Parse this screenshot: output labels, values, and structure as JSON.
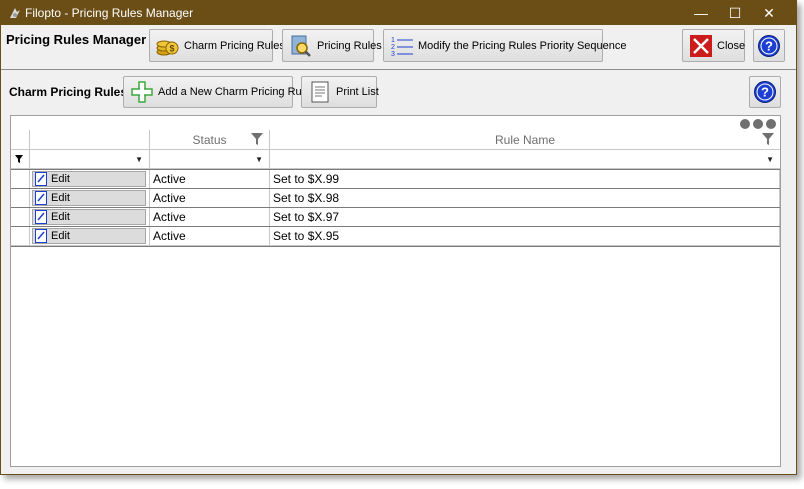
{
  "window": {
    "title": "Filopto - Pricing Rules Manager",
    "controls": {
      "minimize": "—",
      "maximize": "☐",
      "close": "✕"
    }
  },
  "toolbar": {
    "heading": "Pricing Rules Manager",
    "charm_pricing_rules": "Charm Pricing Rules",
    "pricing_rules": "Pricing Rules",
    "modify_priority": "Modify the Pricing Rules Priority Sequence",
    "close": "Close"
  },
  "subtoolbar": {
    "heading": "Charm Pricing Rules",
    "add_rule": "Add a New Charm Pricing Rule",
    "print_list": "Print List"
  },
  "grid": {
    "columns": [
      "",
      "Status",
      "Rule Name"
    ],
    "rows": [
      {
        "action": "Edit",
        "status": "Active",
        "rule_name": "Set to $X.99"
      },
      {
        "action": "Edit",
        "status": "Active",
        "rule_name": "Set to $X.98"
      },
      {
        "action": "Edit",
        "status": "Active",
        "rule_name": "Set to $X.97"
      },
      {
        "action": "Edit",
        "status": "Active",
        "rule_name": "Set to $X.95"
      }
    ]
  },
  "colors": {
    "titlebar": "#6b4e16",
    "help_blue": "#1c3fd1",
    "close_red": "#cc1b1b",
    "add_green": "#3ea83e"
  },
  "icons": [
    "app-icon",
    "coins-icon",
    "search-rules-icon",
    "numbered-list-icon",
    "close-x-icon",
    "help-icon",
    "add-icon",
    "print-icon",
    "edit-icon",
    "filter-icon",
    "dropdown-caret-icon",
    "more-dots-icon"
  ]
}
